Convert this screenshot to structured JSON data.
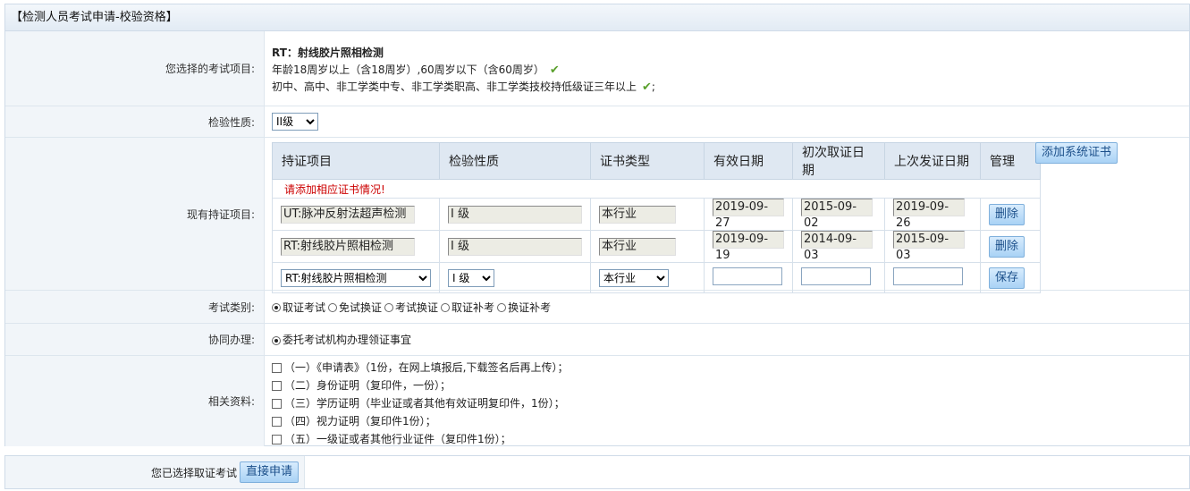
{
  "title": "【检测人员考试申请-校验资格】",
  "exam_item": {
    "label": "您选择的考试项目:",
    "name": "RT：射线胶片照相检测",
    "req_age": "年龄18周岁以上（含18周岁）,60周岁以下（含60周岁）",
    "req_edu": "初中、高中、非工学类中专、非工学类职高、非工学类技校持低级证三年以上",
    "req_edu_suffix": ";"
  },
  "nature": {
    "label": "检验性质:",
    "selected": "II级"
  },
  "certs": {
    "label": "现有持证项目:",
    "headers": [
      "持证项目",
      "检验性质",
      "证书类型",
      "有效日期",
      "初次取证日期",
      "上次发证日期",
      "管理"
    ],
    "note": "请添加相应证书情况!",
    "add_button": "添加系统证书",
    "rows": [
      {
        "item": "UT:脉冲反射法超声检测",
        "level": "I 级",
        "type": "本行业",
        "valid": "2019-09-27",
        "first": "2015-09-02",
        "last": "2019-09-26",
        "action": "删除"
      },
      {
        "item": "RT:射线胶片照相检测",
        "level": "I 级",
        "type": "本行业",
        "valid": "2019-09-19",
        "first": "2014-09-03",
        "last": "2015-09-03",
        "action": "删除"
      }
    ],
    "new_row": {
      "item": "RT:射线胶片照相检测",
      "level": "I 级",
      "type": "本行业",
      "action": "保存"
    }
  },
  "exam_type": {
    "label": "考试类别:",
    "options": [
      "取证考试",
      "免试换证",
      "考试换证",
      "取证补考",
      "换证补考"
    ],
    "selected_index": 0
  },
  "assist": {
    "label": "协同办理:",
    "option": "委托考试机构办理领证事宜"
  },
  "materials": {
    "label": "相关资料:",
    "items": [
      "（一）《申请表》（1份，在网上填报后,下载签名后再上传）；",
      "（二）身份证明（复印件，一份）；",
      "（三）学历证明（毕业证或者其他有效证明复印件，1份）；",
      "（四）视力证明（复印件1份）；",
      "（五）一级证或者其他行业证件（复印件1份）；"
    ]
  },
  "footer": {
    "text": "您已选择取证考试",
    "button": "直接申请"
  }
}
